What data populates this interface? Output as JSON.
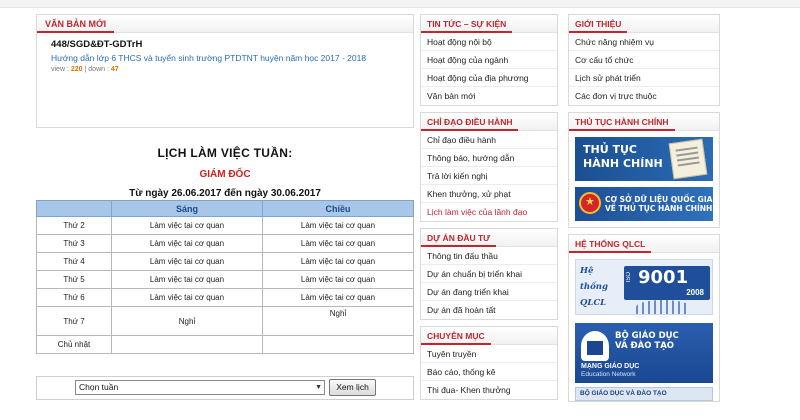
{
  "new_docs": {
    "title": "Văn bản mới",
    "doc_number": "448/SGD&ĐT-GDTrH",
    "doc_title": "Hướng dẫn lớp 6 THCS và tuyển sinh trường PTDTNT huyện năm học 2017 - 2018",
    "view_label": "view :",
    "view_count": "220",
    "sep": "|",
    "down_label": "down :",
    "down_count": "47"
  },
  "schedule": {
    "title": "LỊCH LÀM VIỆC TUẦN:",
    "person": "GIÁM ĐỐC",
    "range": "Từ ngày 26.06.2017 đến ngày 30.06.2017",
    "headers": [
      "",
      "Sáng",
      "Chiều"
    ],
    "rows": [
      {
        "day": "Thứ 2",
        "morning": "Làm việc tai cơ quan",
        "afternoon": "Làm việc tai cơ quan"
      },
      {
        "day": "Thứ 3",
        "morning": "Làm việc tai cơ quan",
        "afternoon": "Làm việc tai cơ quan"
      },
      {
        "day": "Thứ 4",
        "morning": "Làm việc tai cơ quan",
        "afternoon": "Làm việc tai cơ quan"
      },
      {
        "day": "Thứ 5",
        "morning": "Làm việc tai cơ quan",
        "afternoon": "Làm việc tai cơ quan"
      },
      {
        "day": "Thứ 6",
        "morning": "Làm việc tai cơ quan",
        "afternoon": "Làm việc tai cơ quan"
      },
      {
        "day": "Thứ 7",
        "morning": "Nghỉ",
        "afternoon": "Nghỉ"
      },
      {
        "day": "Chủ nhật",
        "morning": "",
        "afternoon": ""
      }
    ],
    "week_select_value": "Chọn tuần",
    "view_button": "Xem lịch"
  },
  "news": {
    "title": "Tin tức – Sự kiện",
    "items": [
      "Hoạt động nội bộ",
      "Hoạt động của ngành",
      "Hoạt động của địa phương",
      "Văn bản mới"
    ]
  },
  "direction": {
    "title": "Chỉ đạo điều hành",
    "items": [
      "Chỉ đạo điều hành",
      "Thông báo, hướng dẫn",
      "Trả lời kiến nghị",
      "Khen thưởng, xử phạt",
      "Lịch làm việc của lãnh đạo"
    ],
    "active_index": 4
  },
  "projects": {
    "title": "Dự án đầu tư",
    "items": [
      "Thông tin đấu thầu",
      "Dự án chuẩn bị triển khai",
      "Dự án đang triển khai",
      "Dự án đã hoàn tất"
    ]
  },
  "topics": {
    "title": "Chuyên mục",
    "items": [
      "Tuyên truyền",
      "Báo cáo, thống kê",
      "Thi đua- Khen thưởng"
    ]
  },
  "intro": {
    "title": "Giới thiệu",
    "items": [
      "Chức năng nhiệm vụ",
      "Cơ cấu tổ chức",
      "Lịch sử phát triển",
      "Các đơn vị trực thuộc"
    ]
  },
  "procedures": {
    "title": "Thủ tục hành chính",
    "banner1_line1": "THỦ TỤC",
    "banner1_line2": "HÀNH CHÍNH",
    "banner2_line1": "CƠ SỞ DỮ LIỆU QUỐC GIA",
    "banner2_line2": "VỀ THỦ TỤC HÀNH CHÍNH"
  },
  "qlcl": {
    "title": "Hệ thống QLCL",
    "he": "Hệ",
    "thong": "thống",
    "qlcl": "QLCL",
    "iso_label": "ISO",
    "iso_number": "9001",
    "iso_year": "2008"
  },
  "moet": {
    "line1": "BỘ GIÁO DỤC",
    "line2": "VÀ ĐÀO TẠO",
    "network1": "MẠNG GIÁO DỤC",
    "network2": "Education Network",
    "strip": "BỘ GIÁO DỤC VÀ ĐÀO TẠO"
  }
}
